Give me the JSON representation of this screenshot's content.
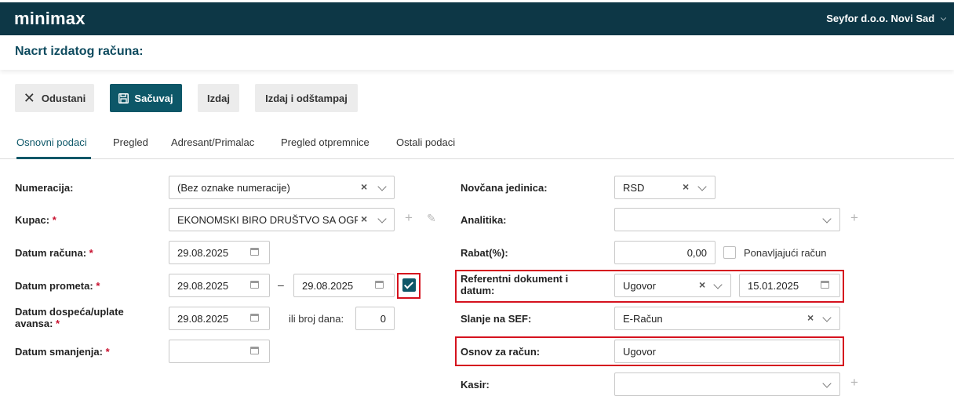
{
  "header": {
    "logo": "minimax",
    "company": "Seyfor d.o.o. Novi Sad"
  },
  "page": {
    "title": "Nacrt izdatog računa:"
  },
  "toolbar": {
    "cancel_label": "Odustani",
    "save_label": "Sačuvaj",
    "issue_label": "Izdaj",
    "issue_print_label": "Izdaj i odštampaj"
  },
  "tabs": [
    {
      "label": "Osnovni podaci",
      "active": true
    },
    {
      "label": "Pregled"
    },
    {
      "label": "Adresant/Primalac"
    },
    {
      "label": "Pregled otpremnice"
    },
    {
      "label": "Ostali podaci"
    }
  ],
  "left": {
    "numbering": {
      "label": "Numeracija:",
      "value": "(Bez oznake numeracije)"
    },
    "customer": {
      "label": "Kupac:",
      "required": "*",
      "value": "EKONOMSKI BIRO DRUŠTVO SA OGR..."
    },
    "invoice_date": {
      "label": "Datum računa:",
      "required": "*",
      "value": "29.08.2025"
    },
    "turnover_date": {
      "label": "Datum prometa:",
      "required": "*",
      "from": "29.08.2025",
      "separator": "–",
      "to": "29.08.2025",
      "range_checked": true
    },
    "due_date": {
      "label": "Datum dospeća/uplate avansa:",
      "required": "*",
      "value": "29.08.2025",
      "days_label": "ili broj dana:",
      "days_value": "0"
    },
    "reduction_date": {
      "label": "Datum smanjenja:",
      "required": "*",
      "value": ""
    }
  },
  "right": {
    "currency": {
      "label": "Novčana jedinica:",
      "value": "RSD"
    },
    "analytics": {
      "label": "Analitika:",
      "value": ""
    },
    "discount": {
      "label": "Rabat(%):",
      "value": "0,00",
      "recurring_label": "Ponavljajući račun",
      "recurring_checked": false
    },
    "reference": {
      "label": "Referentni dokument i datum:",
      "document": "Ugovor",
      "date": "15.01.2025"
    },
    "sef": {
      "label": "Slanje na SEF:",
      "value": "E-Račun"
    },
    "basis": {
      "label": "Osnov za račun:",
      "value": "Ugovor"
    },
    "cashier": {
      "label": "Kasir:",
      "value": ""
    }
  },
  "colors": {
    "header_bg": "#0d3746",
    "accent": "#0d5768",
    "highlight": "#d5121e",
    "required": "#c8102e"
  },
  "icons": [
    "close-icon",
    "save-icon",
    "calendar-icon",
    "chevron-down-icon",
    "clear-icon",
    "plus-icon",
    "pencil-icon",
    "checkmark-icon"
  ]
}
